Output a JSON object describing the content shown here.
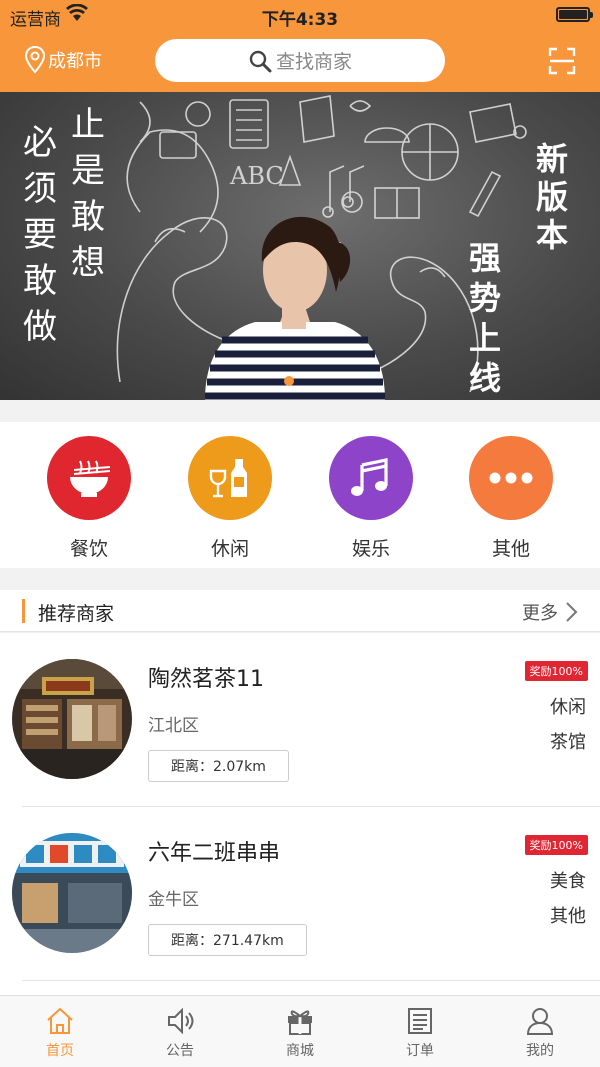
{
  "status": {
    "carrier": "运营商",
    "time": "下午4:33"
  },
  "header": {
    "city": "成都市",
    "search_placeholder": "查找商家",
    "scan_icon": "scan-icon"
  },
  "banner": {
    "left_col1": "必须要敢做",
    "left_col2": "止是敢想",
    "right_top": "新版本",
    "right_bottom": "强势上线"
  },
  "categories": [
    {
      "label": "餐饮",
      "color": "#e0262e",
      "icon": "noodle-bowl-icon"
    },
    {
      "label": "休闲",
      "color": "#ee9a1a",
      "icon": "wine-icon"
    },
    {
      "label": "娱乐",
      "color": "#8e44c9",
      "icon": "music-note-icon"
    },
    {
      "label": "其他",
      "color": "#f57a3d",
      "icon": "more-dots-icon"
    }
  ],
  "recommend": {
    "title": "推荐商家",
    "more": "更多"
  },
  "merchants": [
    {
      "name": "陶然茗茶11",
      "district": "江北区",
      "distance": "距离：2.07km",
      "reward": "奖励100%",
      "tag1": "休闲",
      "tag2": "茶馆"
    },
    {
      "name": "六年二班串串",
      "district": "金牛区",
      "distance": "距离：271.47km",
      "reward": "奖励100%",
      "tag1": "美食",
      "tag2": "其他"
    }
  ],
  "tabs": [
    {
      "label": "首页",
      "icon": "home-icon",
      "active": true
    },
    {
      "label": "公告",
      "icon": "speaker-icon",
      "active": false
    },
    {
      "label": "商城",
      "icon": "gift-icon",
      "active": false
    },
    {
      "label": "订单",
      "icon": "list-icon",
      "active": false
    },
    {
      "label": "我的",
      "icon": "user-icon",
      "active": false
    }
  ],
  "colors": {
    "accent": "#f7963a",
    "reward_red": "#e02632"
  }
}
